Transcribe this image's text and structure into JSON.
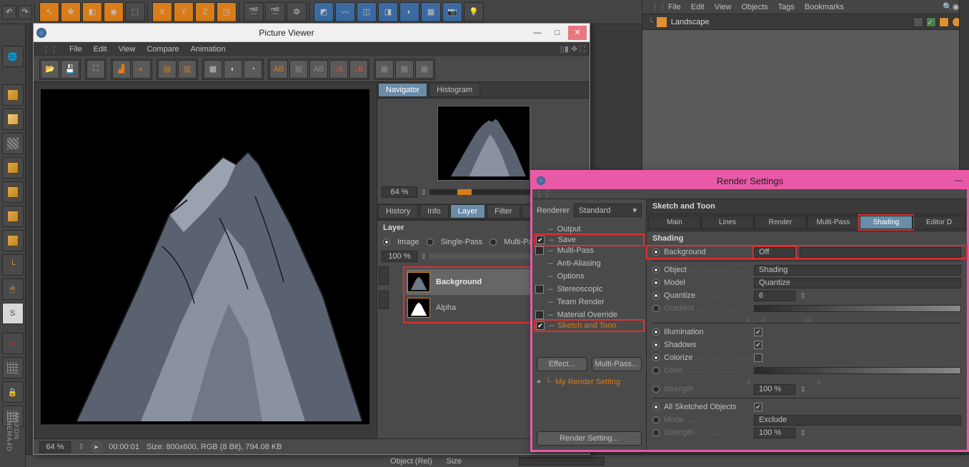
{
  "top_menu": {
    "file": "File",
    "edit": "Edit",
    "view": "View",
    "objects": "Objects",
    "tags": "Tags",
    "bookmarks": "Bookmarks"
  },
  "scene_object": "Landscape",
  "pv": {
    "title": "Picture Viewer",
    "menu": {
      "file": "File",
      "edit": "Edit",
      "view": "View",
      "compare": "Compare",
      "animation": "Animation"
    },
    "nav_tabs": {
      "navigator": "Navigator",
      "histogram": "Histogram"
    },
    "zoom_thumb": "64 %",
    "side_tabs": {
      "history": "History",
      "info": "Info",
      "layer": "Layer",
      "filter": "Filter",
      "stereo": "Stere"
    },
    "layer_head": "Layer",
    "modes": {
      "image": "Image",
      "single": "Single-Pass",
      "multi": "Multi-Pass"
    },
    "layer_zoom": "100 %",
    "layers": {
      "bg": "Background",
      "alpha": "Alpha"
    },
    "status": {
      "zoom": "64 %",
      "time": "00:00:01",
      "size": "Size: 800x600, RGB (8 Bit), 794.08 KB"
    }
  },
  "rs": {
    "title": "Render Settings",
    "renderer_label": "Renderer",
    "renderer_value": "Standard",
    "tree": {
      "output": "Output",
      "save": "Save",
      "multipass": "Multi-Pass",
      "aa": "Anti-Aliasing",
      "options": "Options",
      "stereo": "Stereoscopic",
      "team": "Team Render",
      "mat": "Material Override",
      "sketch": "Sketch and Toon"
    },
    "btn_effect": "Effect...",
    "btn_multipass": "Multi-Pass...",
    "my_setting": "My Render Setting",
    "footer_btn": "Render Setting...",
    "head": "Sketch and Toon",
    "tabs": {
      "main": "Main",
      "lines": "Lines",
      "render": "Render",
      "multipass": "Multi-Pass",
      "shading": "Shading",
      "editor": "Editor D"
    },
    "section_shading": "Shading",
    "rows": {
      "background": {
        "label": "Background",
        "value": "Off"
      },
      "object": {
        "label": "Object",
        "value": "Shading"
      },
      "model": {
        "label": "Model",
        "value": "Quantize"
      },
      "quantize": {
        "label": "Quantize",
        "value": "6"
      },
      "gradient": {
        "label": "Gradient"
      },
      "illumination": {
        "label": "Illumination"
      },
      "shadows": {
        "label": "Shadows"
      },
      "colorize": {
        "label": "Colorize"
      },
      "color": {
        "label": "Color"
      },
      "strength1": {
        "label": "Strength",
        "value": "100 %"
      },
      "allsketched": {
        "label": "All Sketched Objects"
      },
      "mode": {
        "label": "Mode",
        "value": "Exclude"
      },
      "strength2": {
        "label": "Strength",
        "value": "100 %"
      }
    }
  },
  "bottom": {
    "object": "Object (Rel)",
    "size": "Size"
  }
}
